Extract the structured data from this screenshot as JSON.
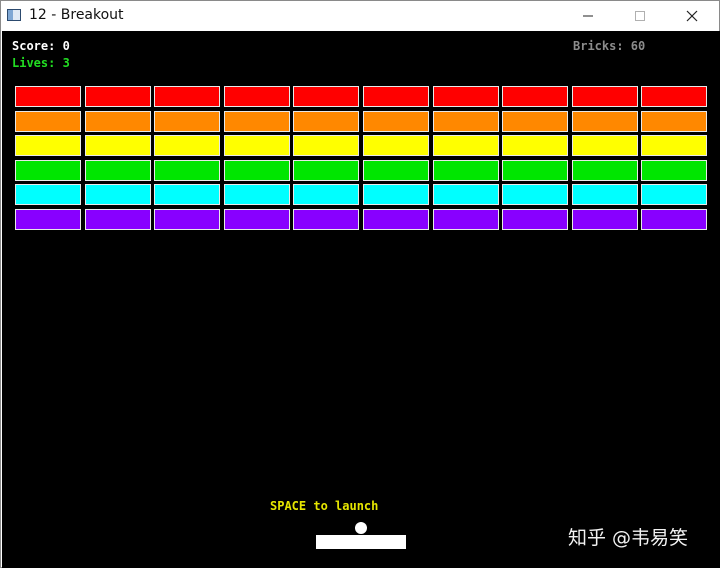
{
  "window": {
    "title": "12 - Breakout"
  },
  "icons": {
    "app": "app-window-icon",
    "minimize": "minimize-icon",
    "maximize": "maximize-icon",
    "close": "close-icon"
  },
  "hud": {
    "score": "Score: 0",
    "lives": "Lives: 3",
    "bricks": "Bricks: 60"
  },
  "game": {
    "hint": "SPACE to launch",
    "brick_rows": [
      {
        "color": "#ff0000",
        "count": 10
      },
      {
        "color": "#ff8800",
        "count": 10
      },
      {
        "color": "#ffff00",
        "count": 10
      },
      {
        "color": "#00e600",
        "count": 10
      },
      {
        "color": "#00ffff",
        "count": 10
      },
      {
        "color": "#8800ff",
        "count": 10
      }
    ]
  },
  "watermark": "知乎 @韦易笑",
  "colors": {
    "background": "#000000",
    "score": "#ffffff",
    "lives": "#22dd22",
    "bricks": "#8c8c8c",
    "hint": "#e6e600",
    "paddle": "#ffffff",
    "ball": "#ffffff"
  }
}
